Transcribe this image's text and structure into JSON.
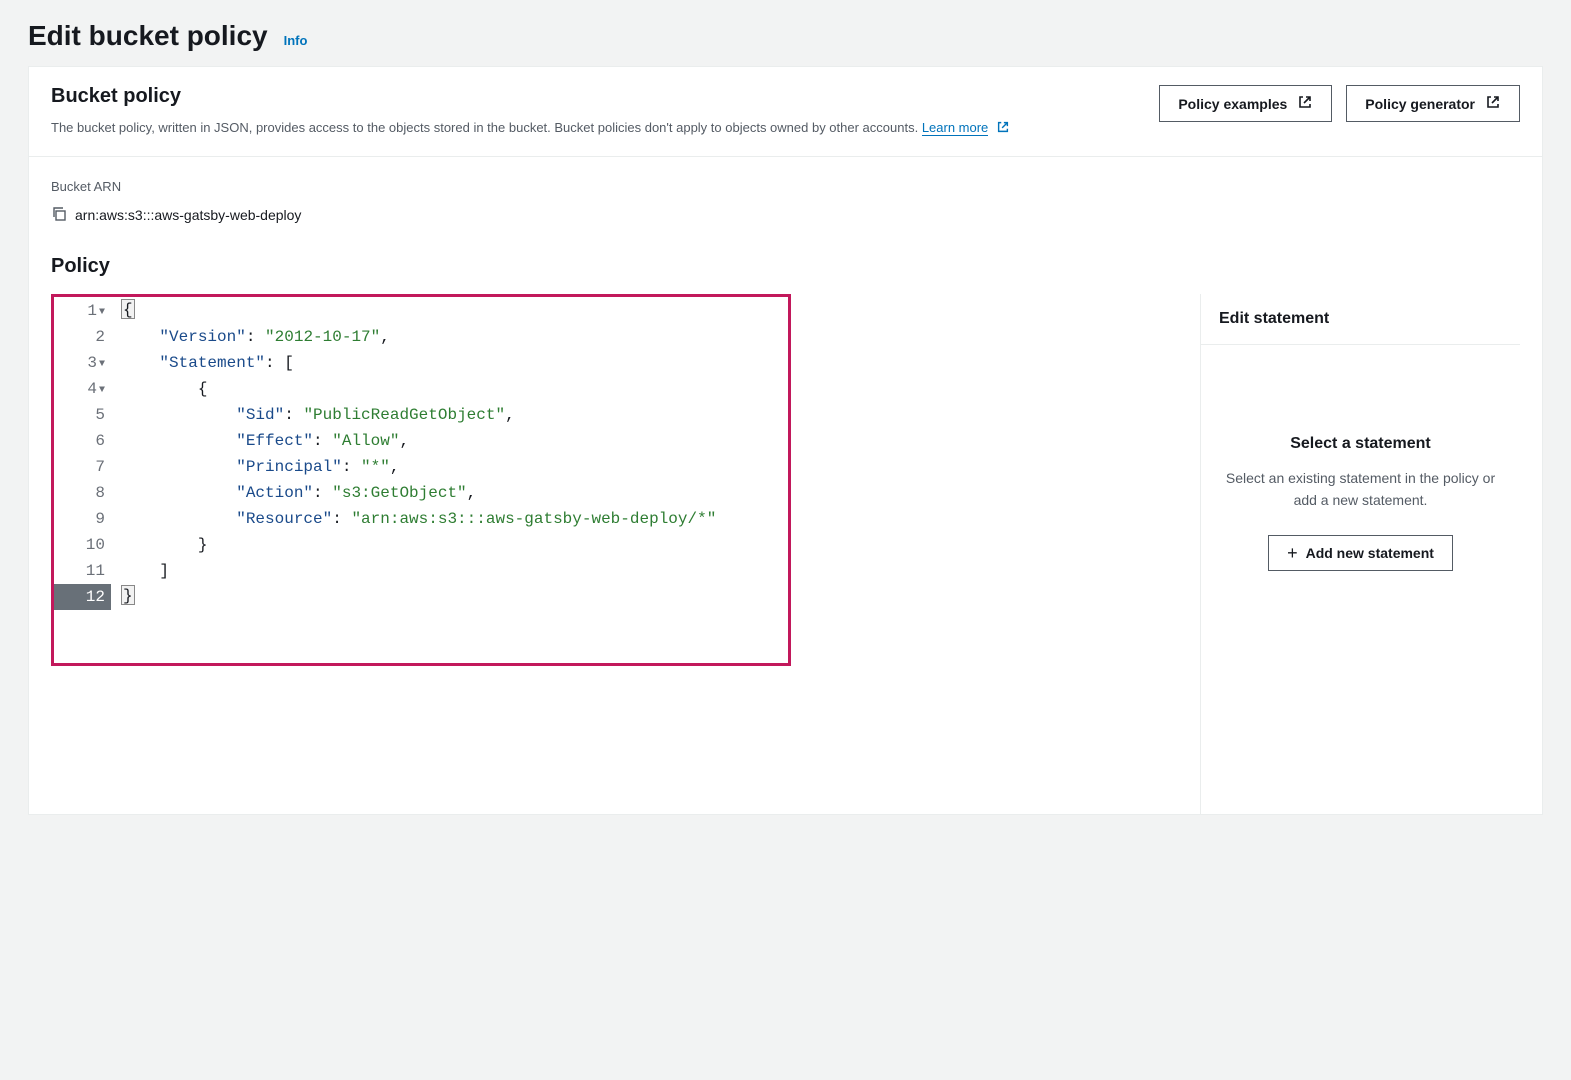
{
  "header": {
    "title": "Edit bucket policy",
    "info_label": "Info"
  },
  "panel": {
    "title": "Bucket policy",
    "description": "The bucket policy, written in JSON, provides access to the objects stored in the bucket. Bucket policies don't apply to objects owned by other accounts. ",
    "learn_more_label": "Learn more",
    "buttons": {
      "policy_examples": "Policy examples",
      "policy_generator": "Policy generator"
    }
  },
  "arn_section": {
    "label": "Bucket ARN",
    "value": "arn:aws:s3:::aws-gatsby-web-deploy"
  },
  "policy_section": {
    "heading": "Policy",
    "lines": [
      {
        "n": 1,
        "fold": true,
        "tokens": [
          [
            "punc",
            "{"
          ]
        ]
      },
      {
        "n": 2,
        "fold": false,
        "tokens": [
          [
            "pad",
            "    "
          ],
          [
            "key",
            "\"Version\""
          ],
          [
            "punc",
            ": "
          ],
          [
            "str",
            "\"2012-10-17\""
          ],
          [
            "punc",
            ","
          ]
        ]
      },
      {
        "n": 3,
        "fold": true,
        "tokens": [
          [
            "pad",
            "    "
          ],
          [
            "key",
            "\"Statement\""
          ],
          [
            "punc",
            ": ["
          ]
        ]
      },
      {
        "n": 4,
        "fold": true,
        "tokens": [
          [
            "pad",
            "        "
          ],
          [
            "punc",
            "{"
          ]
        ]
      },
      {
        "n": 5,
        "fold": false,
        "tokens": [
          [
            "pad",
            "            "
          ],
          [
            "key",
            "\"Sid\""
          ],
          [
            "punc",
            ": "
          ],
          [
            "str",
            "\"PublicReadGetObject\""
          ],
          [
            "punc",
            ","
          ]
        ]
      },
      {
        "n": 6,
        "fold": false,
        "tokens": [
          [
            "pad",
            "            "
          ],
          [
            "key",
            "\"Effect\""
          ],
          [
            "punc",
            ": "
          ],
          [
            "str",
            "\"Allow\""
          ],
          [
            "punc",
            ","
          ]
        ]
      },
      {
        "n": 7,
        "fold": false,
        "tokens": [
          [
            "pad",
            "            "
          ],
          [
            "key",
            "\"Principal\""
          ],
          [
            "punc",
            ": "
          ],
          [
            "str",
            "\"*\""
          ],
          [
            "punc",
            ","
          ]
        ]
      },
      {
        "n": 8,
        "fold": false,
        "tokens": [
          [
            "pad",
            "            "
          ],
          [
            "key",
            "\"Action\""
          ],
          [
            "punc",
            ": "
          ],
          [
            "str",
            "\"s3:GetObject\""
          ],
          [
            "punc",
            ","
          ]
        ]
      },
      {
        "n": 9,
        "fold": false,
        "tokens": [
          [
            "pad",
            "            "
          ],
          [
            "key",
            "\"Resource\""
          ],
          [
            "punc",
            ": "
          ],
          [
            "str",
            "\"arn:aws:s3:::aws-gatsby-web-deploy/*\""
          ]
        ]
      },
      {
        "n": 10,
        "fold": false,
        "tokens": [
          [
            "pad",
            "        "
          ],
          [
            "punc",
            "}"
          ]
        ]
      },
      {
        "n": 11,
        "fold": false,
        "tokens": [
          [
            "pad",
            "    "
          ],
          [
            "punc",
            "]"
          ]
        ]
      },
      {
        "n": 12,
        "fold": false,
        "active": true,
        "tokens": [
          [
            "punc",
            "}"
          ]
        ]
      }
    ]
  },
  "side": {
    "header": "Edit statement",
    "title": "Select a statement",
    "description": "Select an existing statement in the policy or add a new statement.",
    "add_button": "Add new statement"
  }
}
